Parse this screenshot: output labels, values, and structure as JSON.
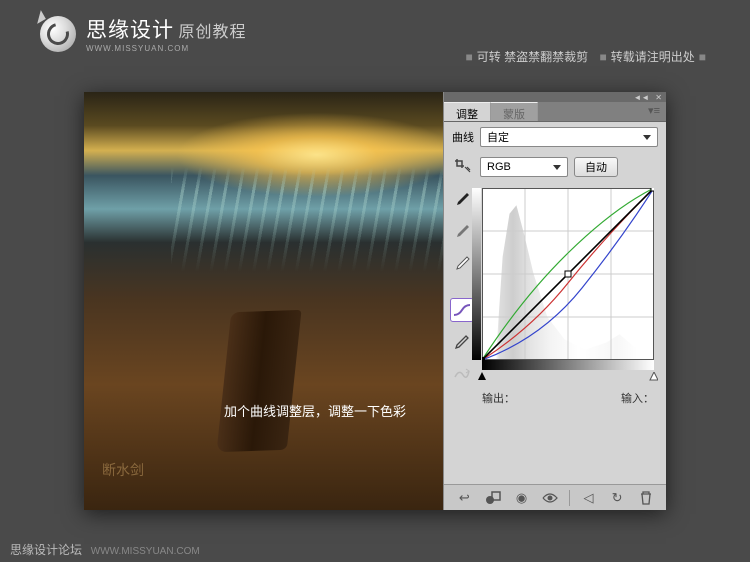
{
  "header": {
    "brand": "思缘设计",
    "brand_suffix": "原创教程",
    "url": "WWW.MISSYUAN.COM"
  },
  "top_note": {
    "part1": "可转  禁盗禁翻禁裁剪",
    "part2": "转载请注明出处"
  },
  "photo": {
    "caption": "加个曲线调整层，调整一下色彩",
    "watermark": "断水剑"
  },
  "panel": {
    "tabs": [
      "调整",
      "蒙版"
    ],
    "adjustment_label": "曲线",
    "preset_value": "自定",
    "channel_value": "RGB",
    "auto_button": "自动",
    "output_label": "输出：",
    "input_label": "输入："
  },
  "footer": {
    "forum": "思缘设计论坛",
    "url": "WWW.MISSYUAN.COM"
  },
  "chart_data": {
    "type": "line",
    "title": "Curves",
    "xlabel": "Input",
    "ylabel": "Output",
    "xlim": [
      0,
      255
    ],
    "ylim": [
      0,
      255
    ],
    "series": [
      {
        "name": "RGB",
        "color": "#000000",
        "values": [
          [
            0,
            0
          ],
          [
            128,
            128
          ],
          [
            255,
            255
          ]
        ]
      },
      {
        "name": "R",
        "color": "#cc3333",
        "values": [
          [
            0,
            0
          ],
          [
            64,
            50
          ],
          [
            128,
            115
          ],
          [
            192,
            190
          ],
          [
            255,
            255
          ]
        ]
      },
      {
        "name": "G",
        "color": "#33aa33",
        "values": [
          [
            0,
            0
          ],
          [
            64,
            78
          ],
          [
            128,
            150
          ],
          [
            192,
            210
          ],
          [
            255,
            255
          ]
        ]
      },
      {
        "name": "B",
        "color": "#3344cc",
        "values": [
          [
            0,
            0
          ],
          [
            64,
            40
          ],
          [
            128,
            100
          ],
          [
            192,
            185
          ],
          [
            255,
            255
          ]
        ]
      }
    ]
  }
}
